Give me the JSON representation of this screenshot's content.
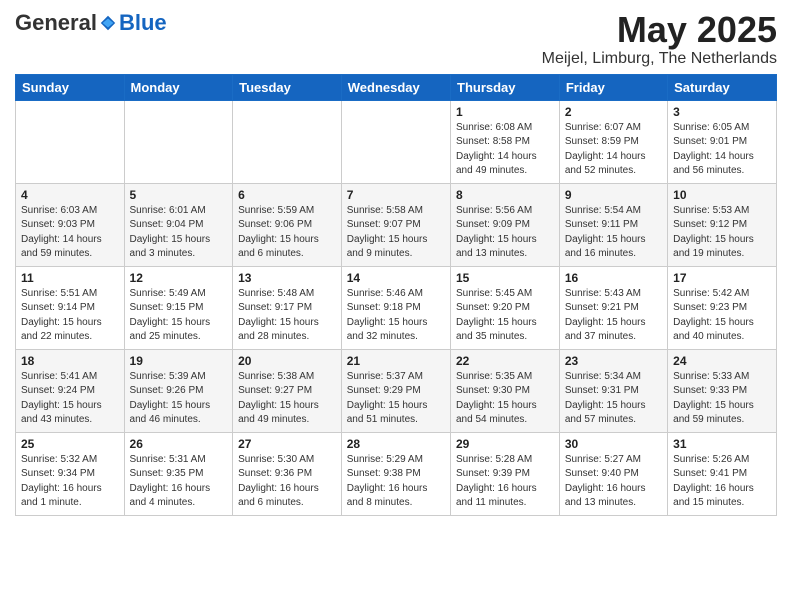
{
  "logo": {
    "general": "General",
    "blue": "Blue"
  },
  "title": "May 2025",
  "location": "Meijel, Limburg, The Netherlands",
  "headers": [
    "Sunday",
    "Monday",
    "Tuesday",
    "Wednesday",
    "Thursday",
    "Friday",
    "Saturday"
  ],
  "rows": [
    {
      "cells": [
        {
          "day": "",
          "info": ""
        },
        {
          "day": "",
          "info": ""
        },
        {
          "day": "",
          "info": ""
        },
        {
          "day": "",
          "info": ""
        },
        {
          "day": "1",
          "info": "Sunrise: 6:08 AM\nSunset: 8:58 PM\nDaylight: 14 hours\nand 49 minutes."
        },
        {
          "day": "2",
          "info": "Sunrise: 6:07 AM\nSunset: 8:59 PM\nDaylight: 14 hours\nand 52 minutes."
        },
        {
          "day": "3",
          "info": "Sunrise: 6:05 AM\nSunset: 9:01 PM\nDaylight: 14 hours\nand 56 minutes."
        }
      ]
    },
    {
      "cells": [
        {
          "day": "4",
          "info": "Sunrise: 6:03 AM\nSunset: 9:03 PM\nDaylight: 14 hours\nand 59 minutes."
        },
        {
          "day": "5",
          "info": "Sunrise: 6:01 AM\nSunset: 9:04 PM\nDaylight: 15 hours\nand 3 minutes."
        },
        {
          "day": "6",
          "info": "Sunrise: 5:59 AM\nSunset: 9:06 PM\nDaylight: 15 hours\nand 6 minutes."
        },
        {
          "day": "7",
          "info": "Sunrise: 5:58 AM\nSunset: 9:07 PM\nDaylight: 15 hours\nand 9 minutes."
        },
        {
          "day": "8",
          "info": "Sunrise: 5:56 AM\nSunset: 9:09 PM\nDaylight: 15 hours\nand 13 minutes."
        },
        {
          "day": "9",
          "info": "Sunrise: 5:54 AM\nSunset: 9:11 PM\nDaylight: 15 hours\nand 16 minutes."
        },
        {
          "day": "10",
          "info": "Sunrise: 5:53 AM\nSunset: 9:12 PM\nDaylight: 15 hours\nand 19 minutes."
        }
      ]
    },
    {
      "cells": [
        {
          "day": "11",
          "info": "Sunrise: 5:51 AM\nSunset: 9:14 PM\nDaylight: 15 hours\nand 22 minutes."
        },
        {
          "day": "12",
          "info": "Sunrise: 5:49 AM\nSunset: 9:15 PM\nDaylight: 15 hours\nand 25 minutes."
        },
        {
          "day": "13",
          "info": "Sunrise: 5:48 AM\nSunset: 9:17 PM\nDaylight: 15 hours\nand 28 minutes."
        },
        {
          "day": "14",
          "info": "Sunrise: 5:46 AM\nSunset: 9:18 PM\nDaylight: 15 hours\nand 32 minutes."
        },
        {
          "day": "15",
          "info": "Sunrise: 5:45 AM\nSunset: 9:20 PM\nDaylight: 15 hours\nand 35 minutes."
        },
        {
          "day": "16",
          "info": "Sunrise: 5:43 AM\nSunset: 9:21 PM\nDaylight: 15 hours\nand 37 minutes."
        },
        {
          "day": "17",
          "info": "Sunrise: 5:42 AM\nSunset: 9:23 PM\nDaylight: 15 hours\nand 40 minutes."
        }
      ]
    },
    {
      "cells": [
        {
          "day": "18",
          "info": "Sunrise: 5:41 AM\nSunset: 9:24 PM\nDaylight: 15 hours\nand 43 minutes."
        },
        {
          "day": "19",
          "info": "Sunrise: 5:39 AM\nSunset: 9:26 PM\nDaylight: 15 hours\nand 46 minutes."
        },
        {
          "day": "20",
          "info": "Sunrise: 5:38 AM\nSunset: 9:27 PM\nDaylight: 15 hours\nand 49 minutes."
        },
        {
          "day": "21",
          "info": "Sunrise: 5:37 AM\nSunset: 9:29 PM\nDaylight: 15 hours\nand 51 minutes."
        },
        {
          "day": "22",
          "info": "Sunrise: 5:35 AM\nSunset: 9:30 PM\nDaylight: 15 hours\nand 54 minutes."
        },
        {
          "day": "23",
          "info": "Sunrise: 5:34 AM\nSunset: 9:31 PM\nDaylight: 15 hours\nand 57 minutes."
        },
        {
          "day": "24",
          "info": "Sunrise: 5:33 AM\nSunset: 9:33 PM\nDaylight: 15 hours\nand 59 minutes."
        }
      ]
    },
    {
      "cells": [
        {
          "day": "25",
          "info": "Sunrise: 5:32 AM\nSunset: 9:34 PM\nDaylight: 16 hours\nand 1 minute."
        },
        {
          "day": "26",
          "info": "Sunrise: 5:31 AM\nSunset: 9:35 PM\nDaylight: 16 hours\nand 4 minutes."
        },
        {
          "day": "27",
          "info": "Sunrise: 5:30 AM\nSunset: 9:36 PM\nDaylight: 16 hours\nand 6 minutes."
        },
        {
          "day": "28",
          "info": "Sunrise: 5:29 AM\nSunset: 9:38 PM\nDaylight: 16 hours\nand 8 minutes."
        },
        {
          "day": "29",
          "info": "Sunrise: 5:28 AM\nSunset: 9:39 PM\nDaylight: 16 hours\nand 11 minutes."
        },
        {
          "day": "30",
          "info": "Sunrise: 5:27 AM\nSunset: 9:40 PM\nDaylight: 16 hours\nand 13 minutes."
        },
        {
          "day": "31",
          "info": "Sunrise: 5:26 AM\nSunset: 9:41 PM\nDaylight: 16 hours\nand 15 minutes."
        }
      ]
    }
  ]
}
